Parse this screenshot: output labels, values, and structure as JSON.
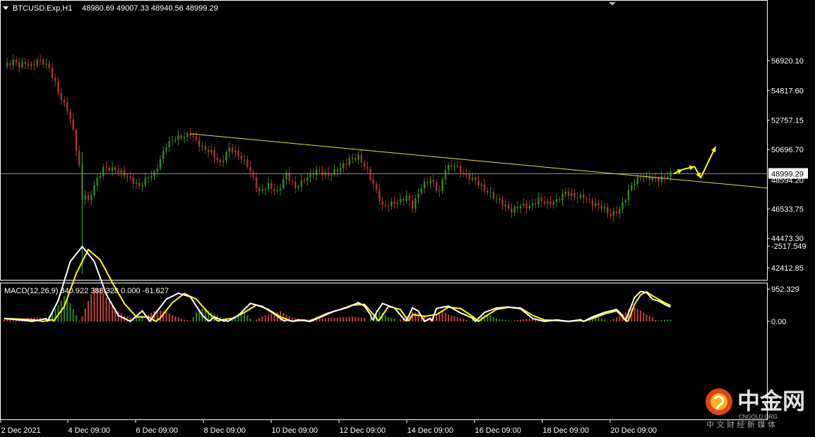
{
  "window": {
    "symbol_header": "BTCUSD.Exp,H1",
    "ohlc_header": "48980.69 49007.33 48940.56 48999.29",
    "macd_header": "MACD(12,26,9) 340.922 388.328 0.000 -61.627"
  },
  "watermark": {
    "brand_cn": "中金网",
    "brand_en": "CNGOLD.ORG",
    "tagline": "中 文 财 经 新 媒 体"
  },
  "colors": {
    "background": "#000000",
    "frame": "#ffffff",
    "candle_up": "#2e8b1f",
    "candle_down": "#b03030",
    "trendline": "#e0e048",
    "price_line": "#8c8c8c",
    "arrow": "#ffff00",
    "macd_line": "#ffffff",
    "signal_line": "#ffff00",
    "hist_up": "#b83a3a",
    "hist_down": "#2e7d1f"
  },
  "chart_data": {
    "type": "candlestick",
    "timeframe": "H1",
    "price_axis": {
      "ticks": [
        56920.1,
        54817.6,
        52757.15,
        50696.7,
        46533.75,
        44473.3,
        42412.85
      ],
      "tick_labels": [
        "56920.10",
        "54817.60",
        "52757.15",
        "50696.70",
        "46533.75",
        "44473.30",
        "42412.85"
      ],
      "visible_range": [
        41600,
        58300
      ]
    },
    "current_price": 48999.29,
    "current_price_label": "48999.29",
    "partially_hidden_label": "48594.20",
    "time_axis": {
      "labels": [
        "2 Dec 2021",
        "4 Dec 09:00",
        "6 Dec 09:00",
        "8 Dec 09:00",
        "10 Dec 09:00",
        "12 Dec 09:00",
        "14 Dec 09:00",
        "16 Dec 09:00",
        "18 Dec 09:00",
        "20 Dec 09:00"
      ]
    },
    "price_path": [
      [
        0,
        56500
      ],
      [
        3,
        56900
      ],
      [
        5,
        56600
      ],
      [
        7,
        56750
      ],
      [
        9,
        56500
      ],
      [
        11,
        56950
      ],
      [
        13,
        56800
      ],
      [
        15,
        56400
      ],
      [
        17,
        55300
      ],
      [
        19,
        54200
      ],
      [
        21,
        53500
      ],
      [
        23,
        52000
      ],
      [
        25,
        49500
      ],
      [
        26,
        47200
      ],
      [
        27,
        47600
      ],
      [
        28,
        47000
      ],
      [
        30,
        48200
      ],
      [
        33,
        49400
      ],
      [
        37,
        49300
      ],
      [
        41,
        48800
      ],
      [
        45,
        48100
      ],
      [
        48,
        48800
      ],
      [
        50,
        49000
      ],
      [
        54,
        51000
      ],
      [
        57,
        51500
      ],
      [
        60,
        51600
      ],
      [
        62,
        51800
      ],
      [
        64,
        51300
      ],
      [
        66,
        50800
      ],
      [
        69,
        50500
      ],
      [
        72,
        49700
      ],
      [
        75,
        50800
      ],
      [
        78,
        50300
      ],
      [
        81,
        49600
      ],
      [
        85,
        47700
      ],
      [
        88,
        48200
      ],
      [
        91,
        47700
      ],
      [
        94,
        49000
      ],
      [
        97,
        48000
      ],
      [
        100,
        48600
      ],
      [
        104,
        49200
      ],
      [
        108,
        48900
      ],
      [
        112,
        49400
      ],
      [
        115,
        50000
      ],
      [
        118,
        50200
      ],
      [
        121,
        49200
      ],
      [
        124,
        47800
      ],
      [
        126,
        46700
      ],
      [
        129,
        46900
      ],
      [
        132,
        47100
      ],
      [
        134,
        47400
      ],
      [
        136,
        46700
      ],
      [
        139,
        48100
      ],
      [
        142,
        48600
      ],
      [
        145,
        47700
      ],
      [
        147,
        49400
      ],
      [
        150,
        49600
      ],
      [
        153,
        49000
      ],
      [
        157,
        48500
      ],
      [
        160,
        47900
      ],
      [
        163,
        47400
      ],
      [
        166,
        46900
      ],
      [
        169,
        46400
      ],
      [
        172,
        46800
      ],
      [
        175,
        46700
      ],
      [
        178,
        47200
      ],
      [
        181,
        46900
      ],
      [
        184,
        47100
      ],
      [
        187,
        47700
      ],
      [
        190,
        47400
      ],
      [
        193,
        47400
      ],
      [
        196,
        46900
      ],
      [
        199,
        46700
      ],
      [
        202,
        46100
      ],
      [
        205,
        46500
      ],
      [
        207,
        47300
      ],
      [
        209,
        48200
      ],
      [
        212,
        48800
      ],
      [
        215,
        48700
      ],
      [
        218,
        48600
      ],
      [
        220,
        48800
      ],
      [
        222,
        48999.29
      ]
    ],
    "trendline": {
      "start": [
        62,
        51800
      ],
      "end": [
        "beyond-right-edge",
        48000
      ]
    },
    "projection_arrows": [
      {
        "from": [
          223,
          48999.29
        ],
        "to": [
          226,
          49300
        ]
      },
      {
        "from": [
          226,
          49300
        ],
        "to": [
          230,
          49500
        ]
      },
      {
        "from": [
          230,
          49500
        ],
        "to": [
          232,
          48700
        ]
      },
      {
        "from": [
          232,
          48700
        ],
        "to": [
          237,
          50900
        ]
      }
    ],
    "macd": {
      "params": "MACD(12,26,9)",
      "macd_value": 340.922,
      "signal_value": 388.328,
      "histogram_zero": 0.0,
      "histogram_value": -61.627,
      "axis_ticks": [
        952.329,
        0.0,
        -2517.549
      ],
      "axis_tick_labels": [
        "952.329",
        "0.00",
        "-2517.549"
      ],
      "macd_path": [
        [
          0,
          -100
        ],
        [
          8,
          -20
        ],
        [
          14,
          80
        ],
        [
          18,
          -700
        ],
        [
          22,
          -2000
        ],
        [
          26,
          -2500
        ],
        [
          30,
          -2000
        ],
        [
          34,
          -900
        ],
        [
          38,
          -200
        ],
        [
          42,
          0
        ],
        [
          46,
          -350
        ],
        [
          50,
          200
        ],
        [
          54,
          650
        ],
        [
          58,
          830
        ],
        [
          62,
          720
        ],
        [
          66,
          180
        ],
        [
          70,
          -150
        ],
        [
          74,
          30
        ],
        [
          78,
          -200
        ],
        [
          82,
          -600
        ],
        [
          86,
          -500
        ],
        [
          90,
          -250
        ],
        [
          94,
          50
        ],
        [
          98,
          -50
        ],
        [
          102,
          0
        ],
        [
          106,
          150
        ],
        [
          110,
          300
        ],
        [
          114,
          400
        ],
        [
          118,
          550
        ],
        [
          120,
          450
        ],
        [
          122,
          200
        ],
        [
          124,
          -300
        ],
        [
          126,
          -600
        ],
        [
          130,
          -450
        ],
        [
          134,
          20
        ],
        [
          136,
          400
        ],
        [
          138,
          300
        ],
        [
          140,
          0
        ],
        [
          142,
          -100
        ],
        [
          144,
          380
        ],
        [
          148,
          450
        ],
        [
          152,
          250
        ],
        [
          156,
          100
        ],
        [
          160,
          -300
        ],
        [
          164,
          -450
        ],
        [
          168,
          -480
        ],
        [
          172,
          -420
        ],
        [
          176,
          -100
        ],
        [
          180,
          0
        ],
        [
          184,
          -50
        ],
        [
          188,
          0
        ],
        [
          192,
          50
        ],
        [
          196,
          -150
        ],
        [
          200,
          -300
        ],
        [
          204,
          -400
        ],
        [
          206,
          -200
        ],
        [
          208,
          250
        ],
        [
          210,
          700
        ],
        [
          212,
          880
        ],
        [
          214,
          850
        ],
        [
          216,
          650
        ],
        [
          218,
          600
        ],
        [
          220,
          500
        ],
        [
          222,
          420
        ]
      ],
      "signal_path": [
        [
          0,
          -100
        ],
        [
          10,
          -50
        ],
        [
          16,
          50
        ],
        [
          20,
          -500
        ],
        [
          24,
          -1600
        ],
        [
          28,
          -2400
        ],
        [
          32,
          -2050
        ],
        [
          36,
          -1300
        ],
        [
          40,
          -600
        ],
        [
          44,
          -150
        ],
        [
          48,
          -150
        ],
        [
          52,
          100
        ],
        [
          56,
          550
        ],
        [
          60,
          820
        ],
        [
          64,
          650
        ],
        [
          68,
          250
        ],
        [
          72,
          -50
        ],
        [
          76,
          -100
        ],
        [
          80,
          -300
        ],
        [
          84,
          -550
        ],
        [
          88,
          -400
        ],
        [
          92,
          -150
        ],
        [
          96,
          0
        ],
        [
          100,
          -50
        ],
        [
          104,
          100
        ],
        [
          108,
          250
        ],
        [
          112,
          350
        ],
        [
          116,
          480
        ],
        [
          120,
          500
        ],
        [
          124,
          100
        ],
        [
          128,
          -500
        ],
        [
          132,
          -400
        ],
        [
          136,
          200
        ],
        [
          140,
          150
        ],
        [
          144,
          200
        ],
        [
          148,
          420
        ],
        [
          152,
          380
        ],
        [
          156,
          150
        ],
        [
          160,
          -150
        ],
        [
          164,
          -400
        ],
        [
          168,
          -470
        ],
        [
          172,
          -450
        ],
        [
          176,
          -200
        ],
        [
          180,
          -50
        ],
        [
          184,
          -30
        ],
        [
          188,
          0
        ],
        [
          192,
          30
        ],
        [
          196,
          -100
        ],
        [
          200,
          -250
        ],
        [
          204,
          -350
        ],
        [
          208,
          50
        ],
        [
          210,
          500
        ],
        [
          212,
          780
        ],
        [
          214,
          870
        ],
        [
          216,
          750
        ],
        [
          218,
          650
        ],
        [
          220,
          550
        ],
        [
          222,
          470
        ]
      ],
      "histogram": [
        [
          0,
          60
        ],
        [
          4,
          80
        ],
        [
          8,
          100
        ],
        [
          12,
          120
        ],
        [
          16,
          -300
        ],
        [
          18,
          -550
        ],
        [
          20,
          -850
        ],
        [
          22,
          -600
        ],
        [
          24,
          -200
        ],
        [
          26,
          150
        ],
        [
          28,
          600
        ],
        [
          30,
          1000
        ],
        [
          32,
          950
        ],
        [
          34,
          700
        ],
        [
          36,
          500
        ],
        [
          38,
          300
        ],
        [
          40,
          180
        ],
        [
          42,
          100
        ],
        [
          44,
          -200
        ],
        [
          46,
          -180
        ],
        [
          48,
          200
        ],
        [
          50,
          300
        ],
        [
          52,
          320
        ],
        [
          54,
          280
        ],
        [
          56,
          180
        ],
        [
          58,
          120
        ],
        [
          60,
          50
        ],
        [
          62,
          20
        ],
        [
          64,
          -300
        ],
        [
          66,
          -420
        ],
        [
          68,
          -350
        ],
        [
          70,
          -250
        ],
        [
          72,
          -150
        ],
        [
          74,
          50
        ],
        [
          76,
          -50
        ],
        [
          78,
          -250
        ],
        [
          80,
          -300
        ],
        [
          82,
          -100
        ],
        [
          84,
          50
        ],
        [
          86,
          150
        ],
        [
          88,
          200
        ],
        [
          90,
          250
        ],
        [
          92,
          300
        ],
        [
          94,
          200
        ],
        [
          96,
          120
        ],
        [
          98,
          80
        ],
        [
          100,
          60
        ],
        [
          104,
          80
        ],
        [
          108,
          100
        ],
        [
          112,
          120
        ],
        [
          116,
          140
        ],
        [
          120,
          100
        ],
        [
          122,
          -100
        ],
        [
          124,
          -380
        ],
        [
          126,
          -300
        ],
        [
          128,
          -150
        ],
        [
          130,
          -100
        ],
        [
          132,
          60
        ],
        [
          134,
          150
        ],
        [
          136,
          280
        ],
        [
          138,
          250
        ],
        [
          140,
          150
        ],
        [
          142,
          80
        ],
        [
          144,
          200
        ],
        [
          146,
          300
        ],
        [
          148,
          200
        ],
        [
          150,
          150
        ],
        [
          152,
          100
        ],
        [
          154,
          50
        ],
        [
          156,
          -80
        ],
        [
          158,
          -150
        ],
        [
          160,
          -220
        ],
        [
          162,
          -200
        ],
        [
          164,
          -100
        ],
        [
          166,
          -60
        ],
        [
          168,
          -30
        ],
        [
          170,
          30
        ],
        [
          172,
          50
        ],
        [
          174,
          80
        ],
        [
          176,
          100
        ],
        [
          178,
          60
        ],
        [
          180,
          30
        ],
        [
          182,
          -40
        ],
        [
          184,
          -80
        ],
        [
          186,
          -60
        ],
        [
          188,
          -30
        ],
        [
          190,
          20
        ],
        [
          192,
          60
        ],
        [
          194,
          -40
        ],
        [
          196,
          -100
        ],
        [
          198,
          -130
        ],
        [
          200,
          -60
        ],
        [
          202,
          30
        ],
        [
          204,
          120
        ],
        [
          206,
          200
        ],
        [
          208,
          350
        ],
        [
          210,
          400
        ],
        [
          212,
          320
        ],
        [
          214,
          200
        ],
        [
          216,
          120
        ],
        [
          218,
          -30
        ],
        [
          220,
          -60
        ],
        [
          222,
          -60
        ]
      ]
    }
  }
}
